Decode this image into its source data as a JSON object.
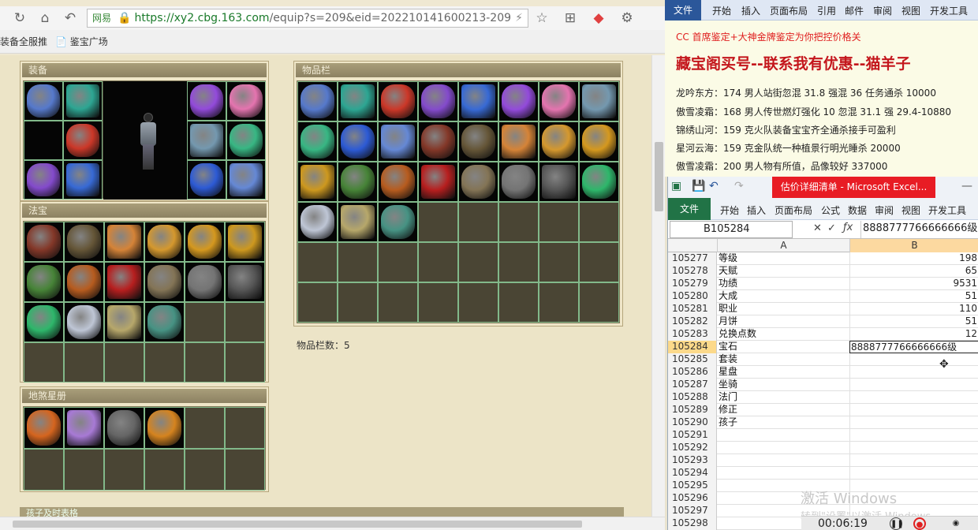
{
  "browser": {
    "url_host": "https://xy2.cbg.163.com",
    "url_path": "/equip?s=209&eid=202210141600213-209",
    "site_badge": "网易",
    "bookmarks": [
      "装备全服推",
      "鉴宝广场"
    ]
  },
  "panels": {
    "equip_title": "装备",
    "treasure_title": "法宝",
    "cards_title": "地煞星册",
    "items_title": "物品栏",
    "items_count_label": "物品栏数：5",
    "next_title": "孩子及时表格"
  },
  "colors": {
    "panel_title_bg": "#9a8f6f",
    "grid_bg": "#4a4534",
    "grid_line": "#82b98a",
    "excel_green": "#217346",
    "word_blue": "#2b579a",
    "selected_row": "#fcd98a"
  },
  "equip_icons": [
    "robe-icon",
    "necklace-icon",
    "helmet-icon",
    "mask-icon",
    "armor-icon",
    "shield-icon",
    "fire-orb-icon",
    "talisman-icon",
    "boots-icon",
    "demon-mask-icon",
    "green-orb-icon"
  ],
  "treasure_icons": [
    "glove-icon",
    "vortex-icon",
    "scroll-icon",
    "pipa-icon",
    "bell-icon",
    "claw-icon",
    "chest-icon",
    "gem-tile-icon",
    "cloth-icon",
    "lantern-icon",
    "flame-icon",
    "ribbon-icon",
    "jade-icon",
    "crystal-icon",
    "tower-icon",
    "whip-icon"
  ],
  "card_icons": [
    "hero-card-1",
    "hero-card-2",
    "hero-card-3",
    "hero-card-4"
  ],
  "item_icons": [
    "jade-ring-icon",
    "scroll-green-icon",
    "red-gem-icon",
    "purple-crystal-icon",
    "blue-gem-icon",
    "purple-gem-icon",
    "heart-gem-icon",
    "silver-ring-icon",
    "green-tile-icon",
    "blue-shell-icon",
    "ice-shard-icon",
    "armor-red-icon",
    "helmet-dark-icon",
    "pizza-icon",
    "dress-icon",
    "crown-icon",
    "gold-mask-icon",
    "leaf-icon",
    "fox-mask-icon",
    "red-cloak-icon",
    "claw-weapon-icon",
    "ring-gray-icon",
    "ring-dark-icon",
    "green-pearl-icon",
    "cloud-icon",
    "boots-gold-icon",
    "spear-icon"
  ],
  "doc": {
    "line1": "CC 首席鉴定+大神金牌鉴定为你把控价格关",
    "line2": "藏宝阁买号--联系我有优惠--猫羊子",
    "entries": [
      "龙吟东方：174 男人站街忽混 31.8 强混 36 任务通杀 10000",
      "傲雪凌霜：168 男人传世燃灯强化 10 忽混 31.1 强 29.4-10880",
      "锦绣山河：159 克火队装备宝宝齐全通杀接手可盈利",
      "星河云海：159 克金队统一种植景行明光睡杀 20000",
      "傲雪凌霜：200 男人物有所值，品像较好 337000"
    ]
  },
  "word_tabs": [
    "文件",
    "开始",
    "插入",
    "页面布局",
    "引用",
    "邮件",
    "审阅",
    "视图",
    "开发工具"
  ],
  "excel": {
    "title": "估价详细清单 - Microsoft Excel...",
    "tabs": [
      "文件",
      "开始",
      "插入",
      "页面布局",
      "公式",
      "数据",
      "审阅",
      "视图",
      "开发工具"
    ],
    "name_box": "B105284",
    "formula_value": "8888777766666666级",
    "col_a": "A",
    "col_b": "B",
    "rows": [
      {
        "n": "105277",
        "a": "等级",
        "b": "198"
      },
      {
        "n": "105278",
        "a": "天赋",
        "b": "65"
      },
      {
        "n": "105279",
        "a": "功绩",
        "b": "9531"
      },
      {
        "n": "105280",
        "a": "大成",
        "b": "51"
      },
      {
        "n": "105281",
        "a": "职业",
        "b": "110"
      },
      {
        "n": "105282",
        "a": "月饼",
        "b": "51"
      },
      {
        "n": "105283",
        "a": "兑换点数",
        "b": "12"
      },
      {
        "n": "105284",
        "a": "宝石",
        "b": "8888777766666666级"
      },
      {
        "n": "105285",
        "a": "套装",
        "b": ""
      },
      {
        "n": "105286",
        "a": "星盘",
        "b": ""
      },
      {
        "n": "105287",
        "a": "坐骑",
        "b": ""
      },
      {
        "n": "105288",
        "a": "法门",
        "b": ""
      },
      {
        "n": "105289",
        "a": "修正",
        "b": ""
      },
      {
        "n": "105290",
        "a": "孩子",
        "b": ""
      },
      {
        "n": "105291",
        "a": "",
        "b": ""
      },
      {
        "n": "105292",
        "a": "",
        "b": ""
      },
      {
        "n": "105293",
        "a": "",
        "b": ""
      },
      {
        "n": "105294",
        "a": "",
        "b": ""
      },
      {
        "n": "105295",
        "a": "",
        "b": ""
      },
      {
        "n": "105296",
        "a": "",
        "b": ""
      },
      {
        "n": "105297",
        "a": "",
        "b": ""
      },
      {
        "n": "105298",
        "a": "",
        "b": ""
      }
    ]
  },
  "watermark": {
    "line1": "激活 Windows",
    "line2": "转到\"设置\"以激活 Windows。"
  },
  "recorder": {
    "time": "00:06:19"
  }
}
